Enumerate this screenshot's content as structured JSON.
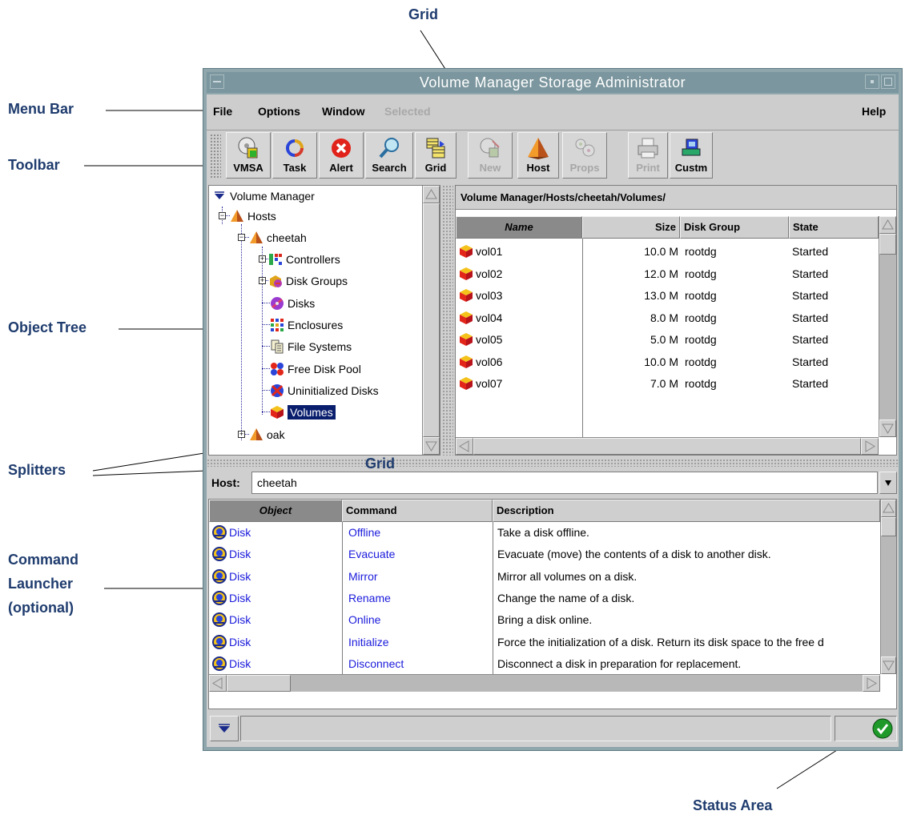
{
  "callouts": {
    "grid_top": "Grid",
    "grid_mid": "Grid",
    "menu_bar": "Menu Bar",
    "toolbar": "Toolbar",
    "object_tree": "Object Tree",
    "splitters": "Splitters",
    "command_launcher": "Command Launcher (optional)",
    "status_area": "Status Area"
  },
  "window": {
    "title": "Volume Manager Storage Administrator"
  },
  "menu": {
    "file": "File",
    "options": "Options",
    "window": "Window",
    "selected": "Selected",
    "help": "Help"
  },
  "toolbar": {
    "buttons": [
      {
        "label": "VMSA",
        "icon": "vmsa-icon",
        "enabled": true
      },
      {
        "label": "Task",
        "icon": "task-icon",
        "enabled": true
      },
      {
        "label": "Alert",
        "icon": "alert-icon",
        "enabled": true
      },
      {
        "label": "Search",
        "icon": "search-icon",
        "enabled": true
      },
      {
        "label": "Grid",
        "icon": "grid-icon",
        "enabled": true
      },
      {
        "label": "New",
        "icon": "new-icon",
        "enabled": false
      },
      {
        "label": "Host",
        "icon": "host-icon",
        "enabled": true
      },
      {
        "label": "Props",
        "icon": "props-icon",
        "enabled": false
      },
      {
        "label": "Print",
        "icon": "print-icon",
        "enabled": false
      },
      {
        "label": "Custm",
        "icon": "custom-icon",
        "enabled": true
      }
    ]
  },
  "tree": {
    "root": "Volume Manager",
    "hosts": "Hosts",
    "host1": "cheetah",
    "controllers": "Controllers",
    "disk_groups": "Disk Groups",
    "disks": "Disks",
    "enclosures": "Enclosures",
    "file_systems": "File Systems",
    "free_disk_pool": "Free Disk Pool",
    "uninitialized_disks": "Uninitialized Disks",
    "volumes": "Volumes",
    "host2": "oak"
  },
  "grid": {
    "path": "Volume Manager/Hosts/cheetah/Volumes/",
    "columns": {
      "name": "Name",
      "size": "Size",
      "disk_group": "Disk Group",
      "state": "State"
    },
    "rows": [
      {
        "name": "vol01",
        "size": "10.0 M",
        "disk_group": "rootdg",
        "state": "Started"
      },
      {
        "name": "vol02",
        "size": "12.0 M",
        "disk_group": "rootdg",
        "state": "Started"
      },
      {
        "name": "vol03",
        "size": "13.0 M",
        "disk_group": "rootdg",
        "state": "Started"
      },
      {
        "name": "vol04",
        "size": "8.0 M",
        "disk_group": "rootdg",
        "state": "Started"
      },
      {
        "name": "vol05",
        "size": "5.0 M",
        "disk_group": "rootdg",
        "state": "Started"
      },
      {
        "name": "vol06",
        "size": "10.0 M",
        "disk_group": "rootdg",
        "state": "Started"
      },
      {
        "name": "vol07",
        "size": "7.0 M",
        "disk_group": "rootdg",
        "state": "Started"
      }
    ]
  },
  "launcher": {
    "host_label": "Host:",
    "host_value": "cheetah",
    "columns": {
      "object": "Object",
      "command": "Command",
      "description": "Description"
    },
    "rows": [
      {
        "object": "Disk",
        "command": "Offline",
        "description": "Take a disk offline."
      },
      {
        "object": "Disk",
        "command": "Evacuate",
        "description": "Evacuate (move) the contents of a disk to another disk."
      },
      {
        "object": "Disk",
        "command": "Mirror",
        "description": "Mirror all volumes on a disk."
      },
      {
        "object": "Disk",
        "command": "Rename",
        "description": "Change the name of a disk."
      },
      {
        "object": "Disk",
        "command": "Online",
        "description": "Bring a disk online."
      },
      {
        "object": "Disk",
        "command": "Initialize",
        "description": "Force the initialization of a disk. Return its disk space to the free d"
      },
      {
        "object": "Disk",
        "command": "Disconnect",
        "description": "Disconnect a disk in preparation for replacement."
      }
    ]
  },
  "colors": {
    "callout": "#1f3c6e",
    "selection": "#0a1e6e",
    "link": "#1a1adc",
    "status_ok": "#1f9a2a"
  }
}
